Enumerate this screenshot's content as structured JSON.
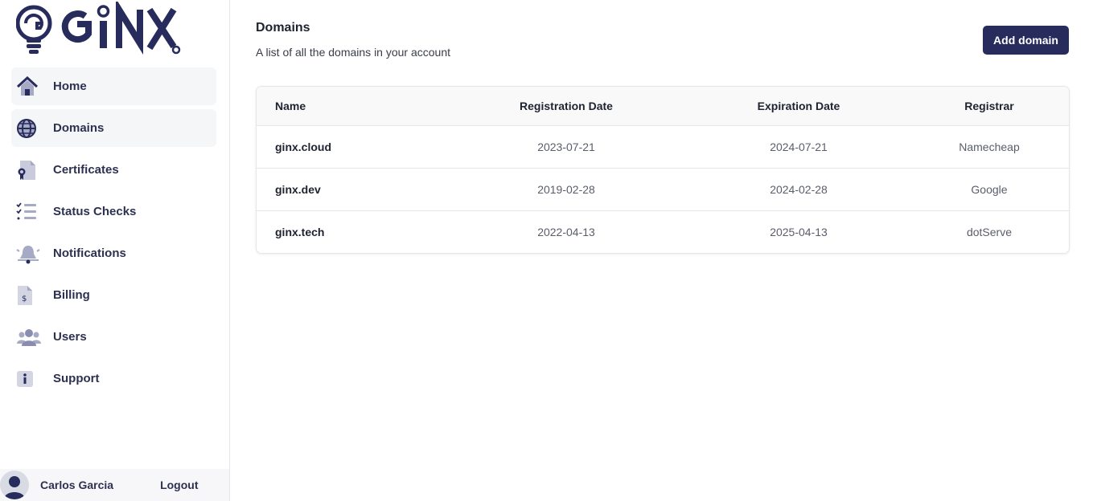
{
  "brand": {
    "logo_text": "GINX"
  },
  "sidebar": {
    "items": [
      {
        "label": "Home",
        "icon": "home-icon"
      },
      {
        "label": "Domains",
        "icon": "globe-icon"
      },
      {
        "label": "Certificates",
        "icon": "certificate-icon"
      },
      {
        "label": "Status Checks",
        "icon": "checklist-icon"
      },
      {
        "label": "Notifications",
        "icon": "bell-icon"
      },
      {
        "label": "Billing",
        "icon": "invoice-icon"
      },
      {
        "label": "Users",
        "icon": "users-icon"
      },
      {
        "label": "Support",
        "icon": "info-icon"
      }
    ]
  },
  "user": {
    "name": "Carlos Garcia",
    "logout_label": "Logout"
  },
  "page": {
    "title": "Domains",
    "subtitle": "A list of all the domains in your account",
    "add_button": "Add domain"
  },
  "table": {
    "columns": [
      "Name",
      "Registration Date",
      "Expiration Date",
      "Registrar"
    ],
    "rows": [
      [
        "ginx.cloud",
        "2023-07-21",
        "2024-07-21",
        "Namecheap"
      ],
      [
        "ginx.dev",
        "2019-02-28",
        "2024-02-28",
        "Google"
      ],
      [
        "ginx.tech",
        "2022-04-13",
        "2025-04-13",
        "dotServe"
      ]
    ]
  },
  "colors": {
    "brand_dark": "#272c5c",
    "icon_muted": "#a7aac4",
    "sidebar_active_bg": "#f5f6f8"
  }
}
